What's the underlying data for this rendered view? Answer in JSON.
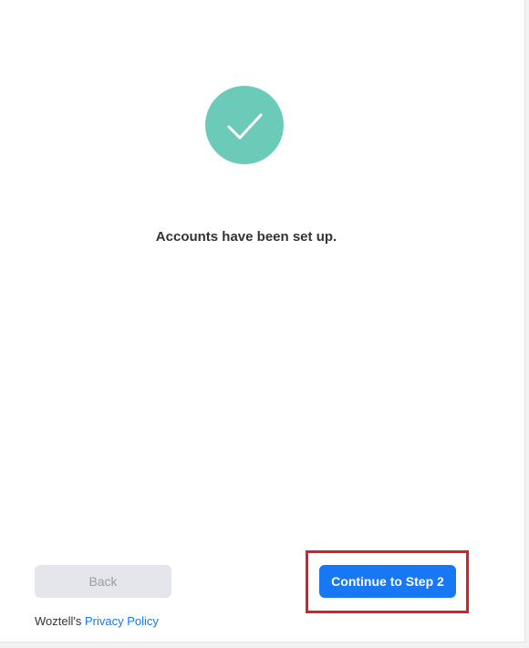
{
  "dialog": {
    "message": "Accounts have been set up.",
    "back_label": "Back",
    "continue_label": "Continue to Step 2",
    "footer_prefix": "Woztell's ",
    "privacy_link": "Privacy Policy"
  },
  "colors": {
    "success": "#6ccbb8",
    "primary": "#1877f2",
    "highlight": "#d8202a"
  },
  "icons": {
    "success": "checkmark-icon"
  }
}
